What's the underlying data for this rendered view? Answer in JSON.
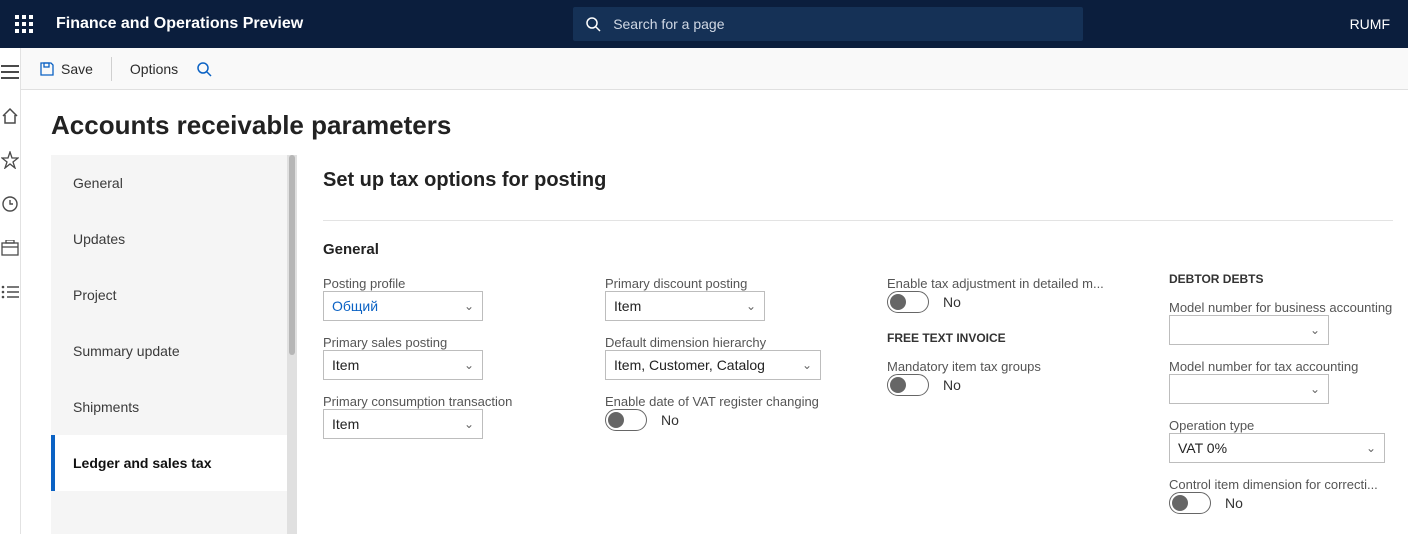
{
  "app": {
    "title": "Finance and Operations Preview",
    "company": "RUMF"
  },
  "search": {
    "placeholder": "Search for a page"
  },
  "actions": {
    "save": "Save",
    "options": "Options"
  },
  "page": {
    "title": "Accounts receivable parameters",
    "section_title": "Set up tax options for posting"
  },
  "sidetabs": {
    "items": [
      {
        "label": "General"
      },
      {
        "label": "Updates"
      },
      {
        "label": "Project"
      },
      {
        "label": "Summary update"
      },
      {
        "label": "Shipments"
      },
      {
        "label": "Ledger and sales tax"
      }
    ],
    "selected_index": 5
  },
  "form": {
    "group_title": "General",
    "col1": {
      "posting_profile": {
        "label": "Posting profile",
        "value": "Общий"
      },
      "primary_sales_posting": {
        "label": "Primary sales posting",
        "value": "Item"
      },
      "primary_consumption": {
        "label": "Primary consumption transaction",
        "value": "Item"
      }
    },
    "col2": {
      "primary_discount_posting": {
        "label": "Primary discount posting",
        "value": "Item"
      },
      "default_dim_hierarchy": {
        "label": "Default dimension hierarchy",
        "value": "Item, Customer, Catalog"
      },
      "enable_vat_date": {
        "label": "Enable date of VAT register changing",
        "value_text": "No"
      }
    },
    "col3": {
      "enable_tax_adj": {
        "label": "Enable tax adjustment in detailed m...",
        "value_text": "No"
      },
      "free_text_invoice_head": "FREE TEXT INVOICE",
      "mandatory_item_tax_groups": {
        "label": "Mandatory item tax groups",
        "value_text": "No"
      }
    },
    "col4": {
      "debtor_debts_head": "DEBTOR DEBTS",
      "model_business": {
        "label": "Model number for business accounting",
        "value": ""
      },
      "model_tax": {
        "label": "Model number for tax accounting",
        "value": ""
      },
      "operation_type": {
        "label": "Operation type",
        "value": "VAT 0%"
      },
      "control_item_dim": {
        "label": "Control item dimension for correcti...",
        "value_text": "No"
      }
    }
  }
}
